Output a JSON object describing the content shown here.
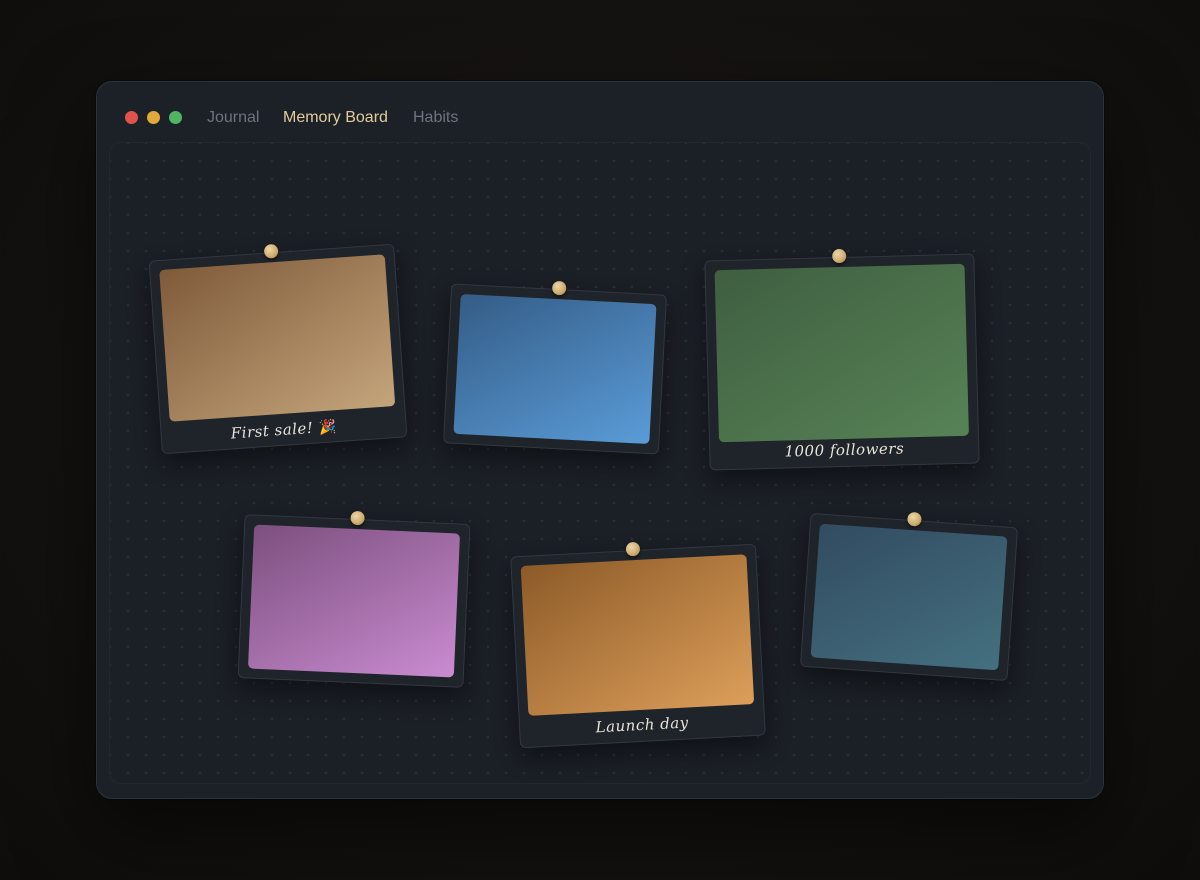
{
  "window": {
    "tabs": [
      {
        "label": "Journal",
        "active": false
      },
      {
        "label": "Memory Board",
        "active": true
      },
      {
        "label": "Habits",
        "active": false
      }
    ]
  },
  "colors": {
    "accent": "#e3cc9c",
    "pin": "#cfae72",
    "traffic_close": "#e0524c",
    "traffic_minimize": "#e0a93a",
    "traffic_zoom": "#4fb560"
  },
  "board": {
    "cards": [
      {
        "caption": "First sale!",
        "emoji": "🎉",
        "gradient": [
          "#7f5a3a",
          "#c4a57b"
        ]
      },
      {
        "caption": "",
        "gradient": [
          "#345c86",
          "#5a9cd8"
        ]
      },
      {
        "caption": "1000 followers",
        "gradient": [
          "#3f5f40",
          "#578256"
        ]
      },
      {
        "caption": "",
        "gradient": [
          "#7c4f7e",
          "#c98cd1"
        ]
      },
      {
        "caption": "Launch day",
        "gradient": [
          "#8c5a28",
          "#dd9f5a"
        ]
      },
      {
        "caption": "",
        "gradient": [
          "#324b60",
          "#44707f"
        ]
      }
    ]
  }
}
